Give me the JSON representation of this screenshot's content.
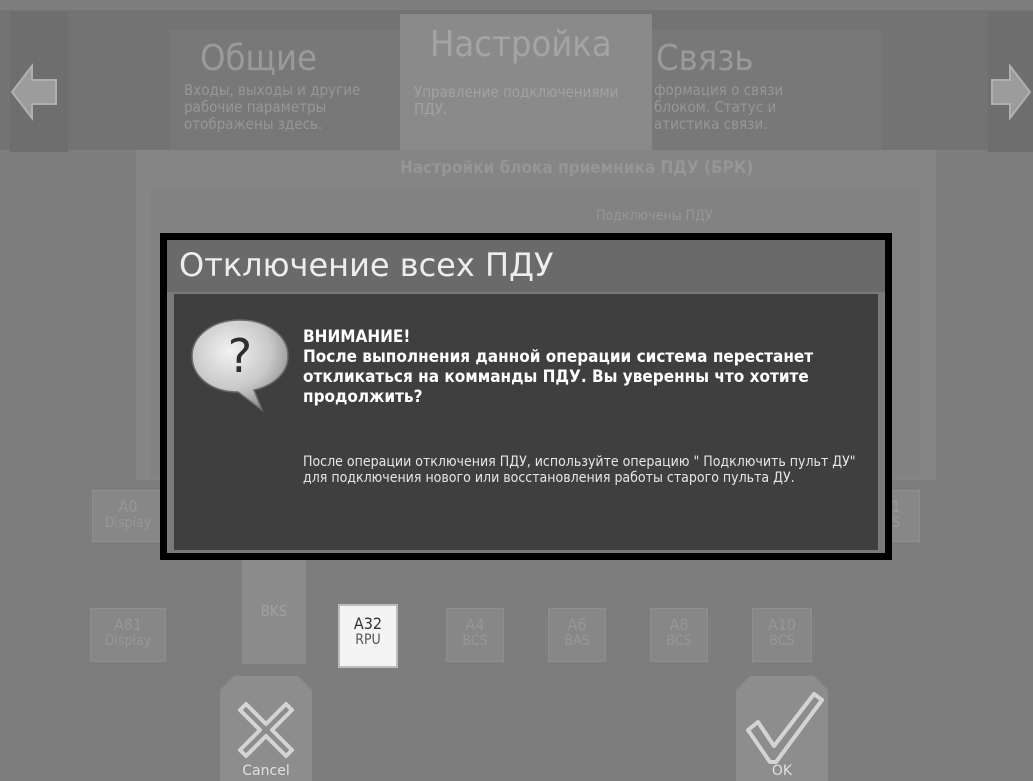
{
  "tabs": [
    {
      "title": "Общие",
      "description": "Входы, выходы и другие\nрабочие параметры\nотображены здесь."
    },
    {
      "title": "Настройка",
      "description": "Управление подключениями\nПДУ."
    },
    {
      "title": "Связь",
      "description": "формация о связи\nблоком. Статус и\nатистика связи."
    }
  ],
  "panel": {
    "title": "Настройки блока приемника ПДУ (БРК)",
    "subtitle": "Подключены ПДУ"
  },
  "devices_row1": [
    {
      "line1": "A0",
      "line2": "Display"
    },
    {
      "line1": "1",
      "line2": "S"
    }
  ],
  "bks_label": "BKS",
  "devices_row2": [
    {
      "line1": "A81",
      "line2": "Display"
    },
    {
      "line1": "A32",
      "line2": "RPU"
    },
    {
      "line1": "A4",
      "line2": "BCS"
    },
    {
      "line1": "A6",
      "line2": "BAS"
    },
    {
      "line1": "A8",
      "line2": "BCS"
    },
    {
      "line1": "A10",
      "line2": "BCS"
    }
  ],
  "buttons": {
    "cancel": "Cancel",
    "ok": "OK"
  },
  "dialog": {
    "title": "Отключение всех ПДУ",
    "warning_heading": "ВНИМАНИЕ!",
    "warning_text": "После выполнения данной операции система перестанет откликаться на комманды ПДУ. Вы уверенны что хотите продолжить?",
    "note": "После операции отключения ПДУ, используйте операцию \" Подключить пульт ДУ\" для подключения нового или восстановления работы старого пульта ДУ.",
    "icon": "question-bubble-icon"
  }
}
